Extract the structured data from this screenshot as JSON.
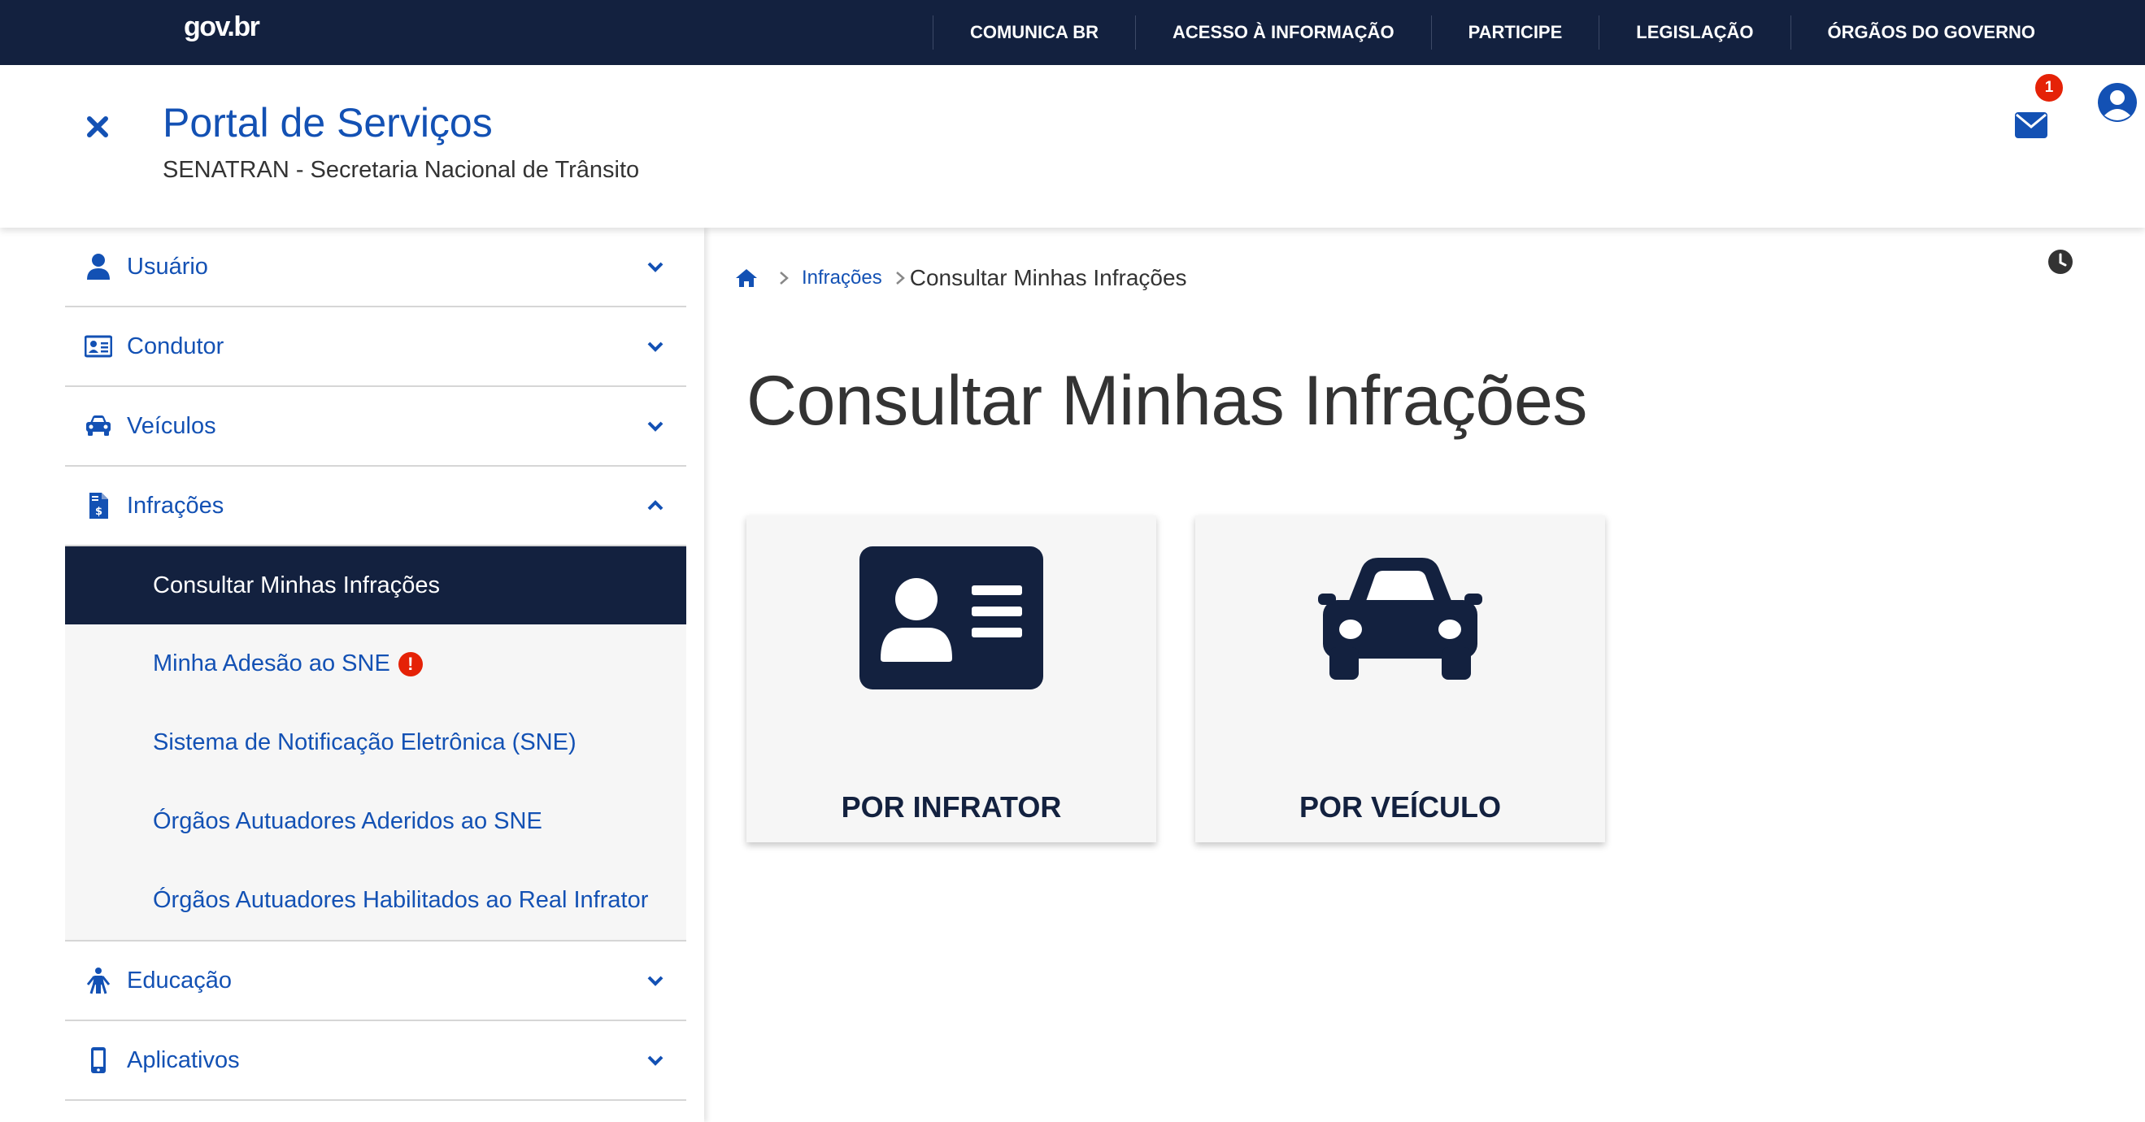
{
  "colors": {
    "navy": "#13213f",
    "primary_blue": "#1351b4",
    "alert_red": "#e52207",
    "card_bg": "#f6f6f6"
  },
  "topbar": {
    "logo": "gov.br",
    "links": [
      "COMUNICA BR",
      "ACESSO À INFORMAÇÃO",
      "PARTICIPE",
      "LEGISLAÇÃO",
      "ÓRGÃOS DO GOVERNO"
    ]
  },
  "header": {
    "close_icon": "close-icon",
    "title": "Portal de Serviços",
    "subtitle": "SENATRAN - Secretaria Nacional de Trânsito",
    "notifications_count": "1",
    "mail_icon": "envelope-icon",
    "avatar_icon": "user-circle-icon"
  },
  "sidebar": {
    "items": [
      {
        "label": "Usuário",
        "icon": "user-icon",
        "expanded": false
      },
      {
        "label": "Condutor",
        "icon": "id-card-icon",
        "expanded": false
      },
      {
        "label": "Veículos",
        "icon": "car-icon",
        "expanded": false
      },
      {
        "label": "Infrações",
        "icon": "file-invoice-dollar-icon",
        "expanded": true
      },
      {
        "label": "Educação",
        "icon": "child-reaching-icon",
        "expanded": false
      },
      {
        "label": "Aplicativos",
        "icon": "mobile-icon",
        "expanded": false
      }
    ],
    "submenu": [
      {
        "label": "Consultar Minhas Infrações",
        "active": true
      },
      {
        "label": "Minha Adesão ao SNE",
        "alert": "!"
      },
      {
        "label": "Sistema de Notificação Eletrônica (SNE)"
      },
      {
        "label": "Órgãos Autuadores Aderidos ao SNE"
      },
      {
        "label": "Órgãos Autuadores Habilitados ao Real Infrator"
      }
    ]
  },
  "main": {
    "breadcrumb": {
      "home_icon": "home-icon",
      "link": "Infrações",
      "current": "Consultar Minhas Infrações"
    },
    "title": "Consultar Minhas Infrações",
    "clock_icon": "clock-icon",
    "cards": [
      {
        "label": "POR INFRATOR",
        "icon": "id-card-icon"
      },
      {
        "label": "POR VEÍCULO",
        "icon": "car-icon"
      }
    ]
  }
}
